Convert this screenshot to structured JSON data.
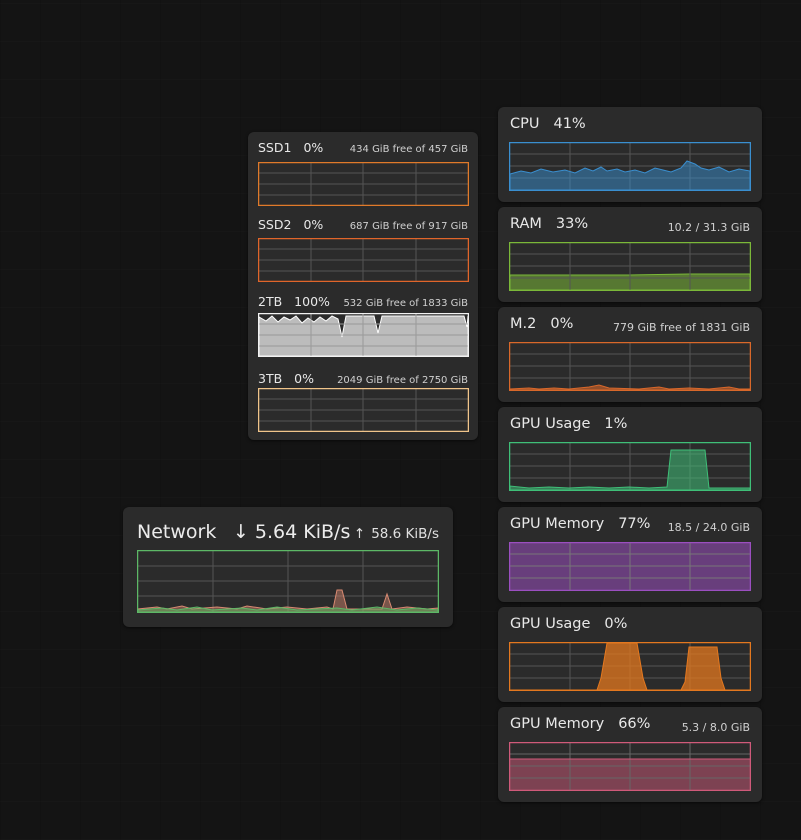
{
  "network": {
    "title": "Network",
    "down_arrow": "↓",
    "down": "5.64 KiB/s",
    "up_arrow": "↑",
    "up": "58.6 KiB/s",
    "colors": [
      "#5db866",
      "#d98a72"
    ]
  },
  "disks": [
    {
      "name": "SSD1",
      "value": "0%",
      "detail": "434 GiB free of 457 GiB",
      "color": "#e07a2a"
    },
    {
      "name": "SSD2",
      "value": "0%",
      "detail": "687 GiB free of 917 GiB",
      "color": "#e0652a"
    },
    {
      "name": "2TB",
      "value": "100%",
      "detail": "532 GiB free of 1833 GiB",
      "color": "#f2f2f2"
    },
    {
      "name": "3TB",
      "value": "0%",
      "detail": "2049 GiB free of 2750 GiB",
      "color": "#f0c48a"
    }
  ],
  "monitors": [
    {
      "name": "CPU",
      "value": "41%",
      "detail": "",
      "color": "#3a8fd0"
    },
    {
      "name": "RAM",
      "value": "33%",
      "detail": "10.2 / 31.3 GiB",
      "color": "#7bb839"
    },
    {
      "name": "M.2",
      "value": "0%",
      "detail": "779 GiB free of 1831 GiB",
      "color": "#d9682a"
    },
    {
      "name": "GPU Usage",
      "value": "1%",
      "detail": "",
      "color": "#3fbf78"
    },
    {
      "name": "GPU Memory",
      "value": "77%",
      "detail": "18.5 / 24.0 GiB",
      "color": "#9b4fc0"
    },
    {
      "name": "GPU Usage",
      "value": "0%",
      "detail": "",
      "color": "#e4781f"
    },
    {
      "name": "GPU Memory",
      "value": "66%",
      "detail": "5.3 / 8.0 GiB",
      "color": "#d05a7a"
    }
  ]
}
